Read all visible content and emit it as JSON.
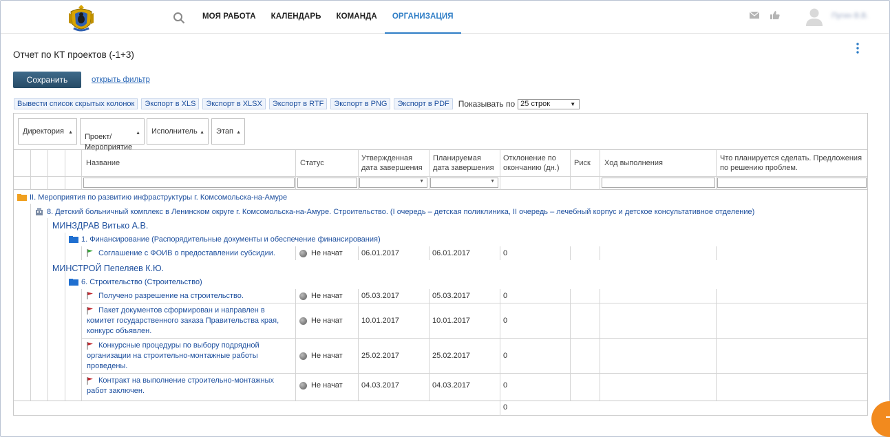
{
  "header": {
    "logo": "coat-of-arms",
    "nav": [
      {
        "label": "МОЯ РАБОТА",
        "active": false
      },
      {
        "label": "КАЛЕНДАРЬ",
        "active": false
      },
      {
        "label": "КОМАНДА",
        "active": false
      },
      {
        "label": "ОРГАНИЗАЦИЯ",
        "active": true
      }
    ],
    "icons": [
      "search-icon",
      "mail-icon",
      "thumbs-up-icon",
      "user-avatar"
    ],
    "user_name": "Пугин В.В."
  },
  "page": {
    "title": "Отчет по КТ проектов (-1+3)",
    "save_label": "Сохранить",
    "filter_link": "открыть фильтр",
    "exports": [
      "Вывести список скрытых колонок",
      "Экспорт в XLS",
      "Экспорт в XLSX",
      "Экспорт в RTF",
      "Экспорт в PNG",
      "Экспорт в PDF"
    ],
    "show_by_label": "Показывать по",
    "rows_value": "25 строк"
  },
  "grid": {
    "group_chips": [
      "Директория",
      "Проект/\nМероприятие",
      "Исполнитель",
      "Этап"
    ],
    "columns": [
      "Название",
      "Статус",
      "Утвержденная дата завершения",
      "Планируемая дата завершения",
      "Отклонение по окончанию (дн.)",
      "Риск",
      "Ход выполнения",
      "Что планируется сделать. Предложения по решению проблем."
    ],
    "directory": "II. Мероприятия по развитию инфраструктуры г. Комсомольска-на-Амуре",
    "project": "8. Детский больничный комплекс в Ленинском округе г. Комсомольска-на-Амуре. Строительство. (I очередь – детская поликлиника, II очередь – лечебный корпус и детское консультативное отделение)",
    "groups": [
      {
        "executor": "МИНЗДРАВ Витько А.В.",
        "stage": "1. Финансирование (Распорядительные документы и обеспечение финансирования)",
        "tasks": [
          {
            "name": "Соглашение с ФОИВ о предоставлении субсидии.",
            "status": "Не начат",
            "approved": "06.01.2017",
            "planned": "06.01.2017",
            "deviation": "0",
            "flag": "#3aa63a"
          }
        ]
      },
      {
        "executor": "МИНСТРОЙ Пепеляев К.Ю.",
        "stage": "6. Строительство (Строительство)",
        "tasks": [
          {
            "name": "Получено разрешение на строительство.",
            "status": "Не начат",
            "approved": "05.03.2017",
            "planned": "05.03.2017",
            "deviation": "0",
            "flag": "#c0262d"
          },
          {
            "name": "Пакет документов сформирован и направлен в комитет государственного заказа Правительства края, конкурс объявлен.",
            "status": "Не начат",
            "approved": "10.01.2017",
            "planned": "10.01.2017",
            "deviation": "0",
            "flag": "#c0262d"
          },
          {
            "name": "Конкурсные процедуры по выбору подрядной организации на строительно-монтажные работы проведены.",
            "status": "Не начат",
            "approved": "25.02.2017",
            "planned": "25.02.2017",
            "deviation": "0",
            "flag": "#c0262d"
          },
          {
            "name": "Контракт на выполнение строительно-монтажных работ заключен.",
            "status": "Не начат",
            "approved": "04.03.2017",
            "planned": "04.03.2017",
            "deviation": "0",
            "flag": "#c0262d"
          }
        ]
      }
    ],
    "footer_total": "0"
  },
  "colors": {
    "accent": "#2e7dc6",
    "link": "#1d4f9e",
    "save_button": "#2f5877",
    "fab": "#f28a1e"
  }
}
